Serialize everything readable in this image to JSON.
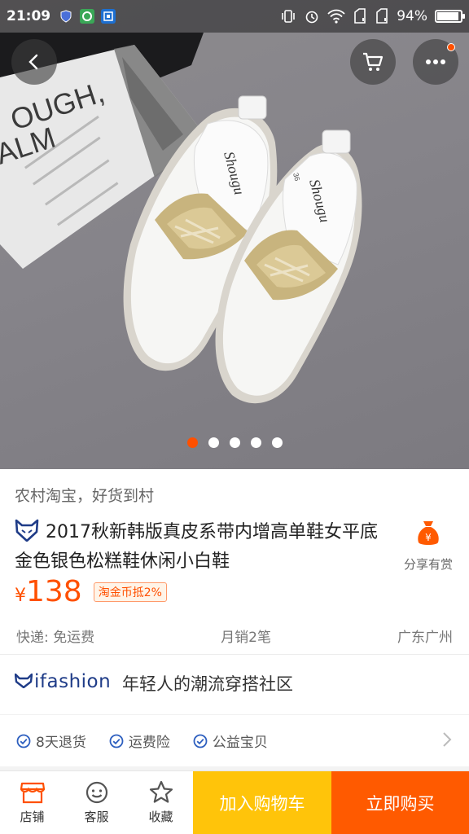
{
  "status_bar": {
    "time": "21:09",
    "battery": "94%",
    "battery_level": 0.94
  },
  "hero": {
    "magazine_lines": [
      "OUGH,",
      "ALM"
    ],
    "shoe_brand": "Shougu",
    "shoe_size": "36",
    "gallery": {
      "count": 5,
      "active_index": 0
    }
  },
  "product": {
    "slogan": "农村淘宝，好货到村",
    "title": "2017秋新韩版真皮系带内增高单鞋女平底金色银色松糕鞋休闲小白鞋",
    "currency": "¥",
    "price": "138",
    "coin_tag": "淘金币抵2%",
    "shipping": "快递: 免运费",
    "monthly_sales": "月销2笔",
    "location": "广东广州",
    "share_label": "分享有赏"
  },
  "ifashion": {
    "logo": "ifashion",
    "tagline": "年轻人的潮流穿搭社区"
  },
  "services": [
    "8天退货",
    "运费险",
    "公益宝贝"
  ],
  "bottom_bar": {
    "store_label": "店铺",
    "service_label": "客服",
    "favorite_label": "收藏",
    "add_to_cart_label": "加入购物车",
    "buy_now_label": "立即购买"
  },
  "colors": {
    "accent": "#ff5000",
    "cart_yellow": "#ffc40a",
    "buy_orange": "#ff5a00",
    "brand_blue": "#1f3c88"
  }
}
